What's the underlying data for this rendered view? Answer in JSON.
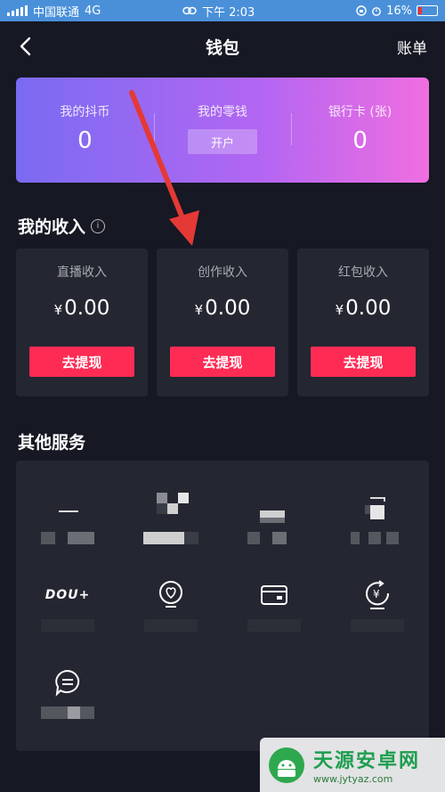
{
  "status_bar": {
    "carrier": "中国联通",
    "network": "4G",
    "time": "下午 2:03",
    "battery": "16%"
  },
  "nav": {
    "title": "钱包",
    "right_label": "账单",
    "back_icon": "chevron-left-icon"
  },
  "wallet": {
    "douyin_coin": {
      "label": "我的抖币",
      "value": "0"
    },
    "change": {
      "label": "我的零钱",
      "button": "开户"
    },
    "bank_card": {
      "label": "银行卡 (张)",
      "value": "0"
    }
  },
  "income": {
    "title": "我的收入",
    "info_icon": "i",
    "items": [
      {
        "label": "直播收入",
        "currency": "¥",
        "amount": "0.00",
        "button": "去提现"
      },
      {
        "label": "创作收入",
        "currency": "¥",
        "amount": "0.00",
        "button": "去提现"
      },
      {
        "label": "红包收入",
        "currency": "¥",
        "amount": "0.00",
        "button": "去提现"
      }
    ]
  },
  "services": {
    "title": "其他服务",
    "items": [
      {
        "icon": "pixelated-icon"
      },
      {
        "icon": "pixelated-icon"
      },
      {
        "icon": "pixelated-icon"
      },
      {
        "icon": "pixelated-icon"
      },
      {
        "icon": "dou-plus-icon",
        "logo_text": "DOU+"
      },
      {
        "icon": "heart-bag-icon"
      },
      {
        "icon": "card-icon"
      },
      {
        "icon": "yen-refresh-icon"
      },
      {
        "icon": "chat-bubble-icon"
      }
    ]
  },
  "watermark": {
    "title": "天源安卓网",
    "url": "www.jytyaz.com"
  },
  "colors": {
    "background": "#161823",
    "card": "#242631",
    "accent": "#fe2c55",
    "status_bar": "#4a90d9",
    "annotation_arrow": "#e53935"
  }
}
